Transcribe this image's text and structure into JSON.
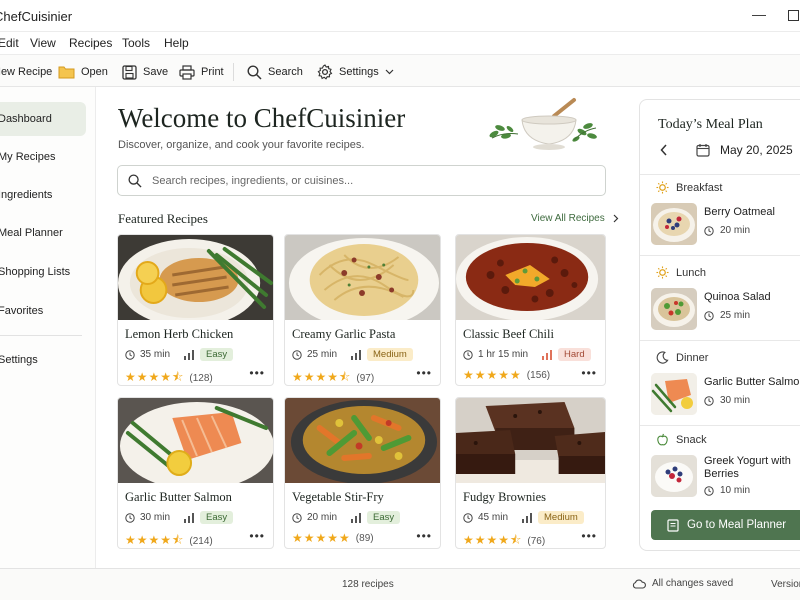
{
  "app": {
    "title": "ChefCuisinier"
  },
  "menu": [
    "Edit",
    "View",
    "Recipes",
    "Tools",
    "Help"
  ],
  "toolbar": {
    "new_recipe": "New Recipe",
    "open": "Open",
    "save": "Save",
    "print": "Print",
    "search": "Search",
    "settings": "Settings"
  },
  "sidebar": {
    "items": [
      {
        "label": "Dashboard",
        "active": true
      },
      {
        "label": "My Recipes"
      },
      {
        "label": "Ingredients"
      },
      {
        "label": "Meal Planner"
      },
      {
        "label": "Shopping Lists"
      },
      {
        "label": "Favorites"
      }
    ],
    "settings": "Settings"
  },
  "main": {
    "welcome": "Welcome to ChefCuisinier",
    "subtitle": "Discover, organize, and cook your favorite recipes.",
    "search_placeholder": "Search recipes, ingredients, or cuisines...",
    "featured_title": "Featured Recipes",
    "view_all": "View All Recipes"
  },
  "recipes": [
    {
      "name": "Lemon Herb Chicken",
      "time": "35 min",
      "difficulty": "Easy",
      "difficulty_color": "#e3efdc",
      "rating": 4.5,
      "reviews": "(128)",
      "icon": "grilled-chicken"
    },
    {
      "name": "Creamy Garlic Pasta",
      "time": "25 min",
      "difficulty": "Medium",
      "difficulty_color": "#fbecc8",
      "rating": 4.5,
      "reviews": "(97)",
      "icon": "pasta"
    },
    {
      "name": "Classic Beef Chili",
      "time": "1 hr 15 min",
      "difficulty": "Hard",
      "difficulty_color": "#f9e0da",
      "rating": 5,
      "reviews": "(156)",
      "icon": "chili-bowl"
    },
    {
      "name": "Garlic Butter Salmon",
      "time": "30 min",
      "difficulty": "Easy",
      "difficulty_color": "#e3efdc",
      "rating": 4.5,
      "reviews": "(214)",
      "icon": "salmon"
    },
    {
      "name": "Vegetable Stir-Fry",
      "time": "20 min",
      "difficulty": "Easy",
      "difficulty_color": "#e3efdc",
      "rating": 5,
      "reviews": "(89)",
      "icon": "stir-fry"
    },
    {
      "name": "Fudgy Brownies",
      "time": "45 min",
      "difficulty": "Medium",
      "difficulty_color": "#fbecc8",
      "rating": 4.5,
      "reviews": "(76)",
      "icon": "brownies"
    }
  ],
  "meal_plan": {
    "title": "Today’s Meal Plan",
    "date": "May 20, 2025",
    "meals": [
      {
        "slot": "Breakfast",
        "slot_icon": "sun-icon",
        "name": "Berry Oatmeal",
        "time": "20 min"
      },
      {
        "slot": "Lunch",
        "slot_icon": "sun-icon",
        "name": "Quinoa Salad",
        "time": "25 min"
      },
      {
        "slot": "Dinner",
        "slot_icon": "moon-icon",
        "name": "Garlic Butter Salmon",
        "time": "30 min"
      },
      {
        "slot": "Snack",
        "slot_icon": "apple-icon",
        "name": "Greek Yogurt with Berries",
        "time": "10 min"
      }
    ],
    "button": "Go to Meal Planner"
  },
  "status": {
    "count": "128 recipes",
    "saved": "All changes saved",
    "version": "Version"
  },
  "colors": {
    "accent": "#4f7550",
    "star": "#f0a81b",
    "active_nav": "#e9eee6"
  }
}
